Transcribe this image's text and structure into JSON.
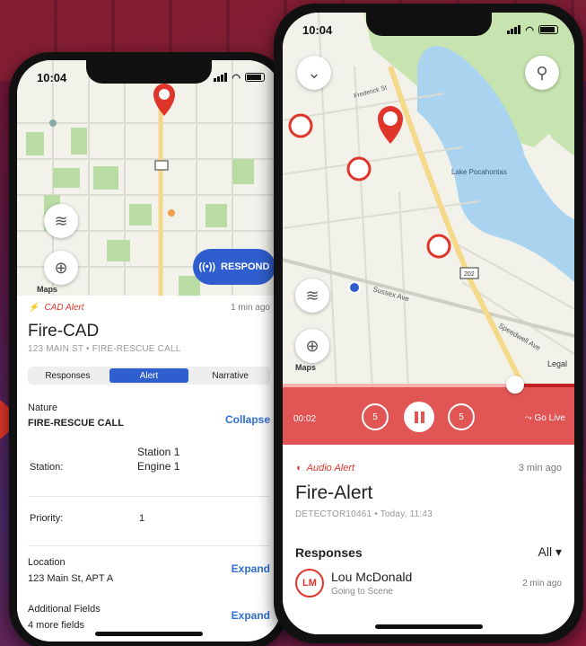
{
  "phone1": {
    "status_time": "10:04",
    "map": {
      "respond_label": "RESPOND",
      "legal_label": "Maps"
    },
    "alert_type": "CAD Alert",
    "alert_ago": "1 min ago",
    "title": "Fire-CAD",
    "subtitle": "123 MAIN ST • FIRE-RESCUE CALL",
    "tabs": [
      {
        "label": "Responses"
      },
      {
        "label": "Alert"
      },
      {
        "label": "Narrative"
      }
    ],
    "details": {
      "nature_label": "Nature",
      "nature_value": "FIRE-RESCUE CALL",
      "collapse_label": "Collapse",
      "station_label": "Station:",
      "station_value_1": "Station 1",
      "station_value_2": "Engine 1",
      "priority_label": "Priority:",
      "priority_value": "1",
      "location_label": "Location",
      "location_value": "123 Main St, APT A",
      "expand_label": "Expand",
      "additional_label": "Additional Fields",
      "additional_value": "4 more fields",
      "expand_label_2": "Expand"
    }
  },
  "phone2": {
    "status_time": "10:04",
    "map": {
      "legal_label": "Maps",
      "legal_right": "Legal",
      "street_1": "Sussex Ave",
      "street_2": "Speedwell Ave",
      "street_3": "Frederick St",
      "lake": "Lake Pocahontas",
      "route": "202"
    },
    "player": {
      "time": "00:02",
      "skip_back": "5",
      "skip_fwd": "5",
      "go_live": "Go Live"
    },
    "alert_type": "Audio Alert",
    "alert_ago": "3 min ago",
    "title": "Fire-Alert",
    "subtitle": "DETECTOR10461 • Today, 11:43",
    "responses_heading": "Responses",
    "filter_label": "All",
    "responder": {
      "initials": "LM",
      "name": "Lou McDonald",
      "status": "Going to Scene",
      "ago": "2 min ago"
    }
  },
  "colors": {
    "accent_red": "#e0352b",
    "accent_blue": "#2f5fcf",
    "player_red": "#e25555"
  }
}
